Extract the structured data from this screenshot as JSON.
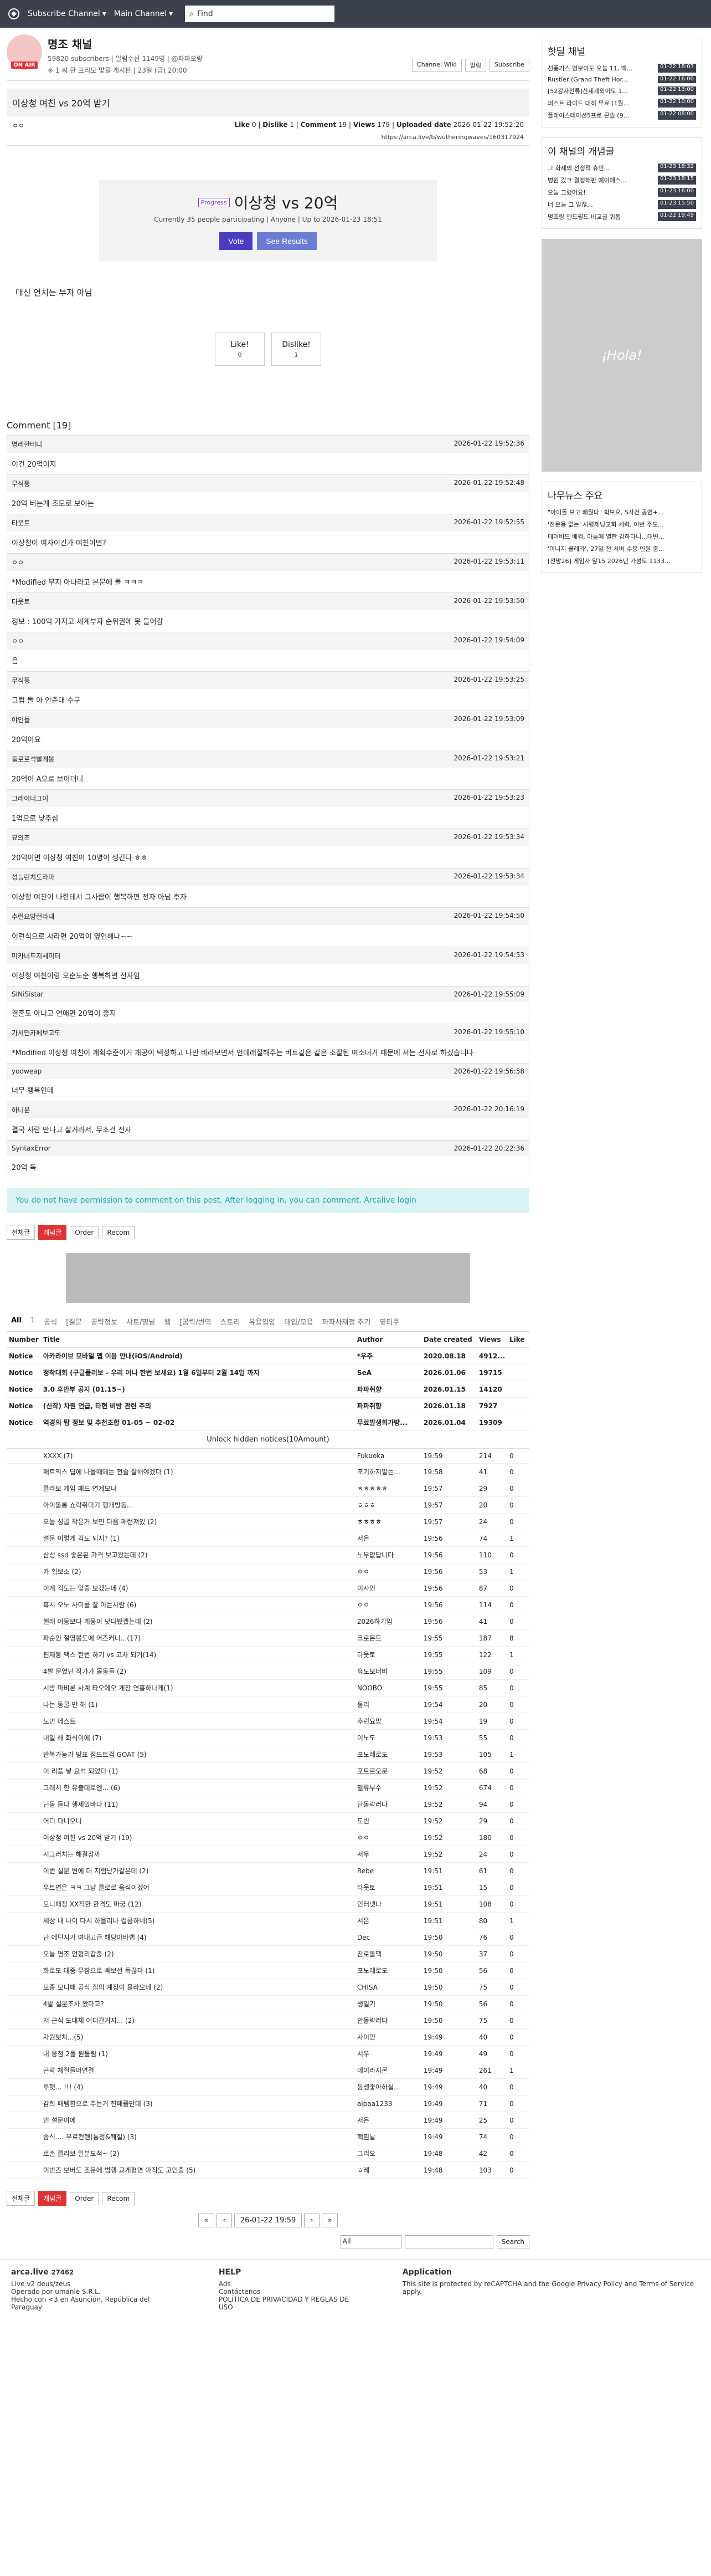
{
  "topbar": {
    "menu1": "Subscribe Channel",
    "menu2": "Main Channel",
    "search_placeholder": "Find"
  },
  "channel": {
    "title": "명조 채널",
    "meta": "59820 subscribers | 알림수신 1149명 | @파파오랑",
    "sub": "※ 1 씨 한 프리모 맞을 게시판 | 23일 (금) 20:00",
    "btn_wiki": "Channel Wiki",
    "btn_alert": "알림",
    "btn_sub": "Subscribe",
    "onair": "ON AIR"
  },
  "post": {
    "title": "이상청 여친 vs 20억 받기",
    "author": "ㅇㅇ",
    "like_label": "Like",
    "like": "0",
    "dislike_label": "Dislike",
    "dislike": "1",
    "comment_label": "Comment",
    "comments": "19",
    "views_label": "Views",
    "views": "179",
    "uploaded_label": "Uploaded date",
    "uploaded": "2026-01-22 19:52:20",
    "link": "https://arca.live/b/wutheringwaves/160317924",
    "body": "대신 연치는 부자 아님"
  },
  "poll": {
    "tag": "Progress",
    "title": "이상청 vs 20억",
    "sub": "Currently 35 people participating | Anyone | Up to 2026-01-23 18:51",
    "vote": "Vote",
    "results": "See Results"
  },
  "likes": {
    "like_label": "Like!",
    "like": "0",
    "dislike_label": "Dislike!",
    "dislike": "1"
  },
  "comments_header": "Comment [19]",
  "comments": [
    {
      "user": "명레한테니",
      "time": "2026-01-22 19:52:36",
      "body": "이건 20억이지"
    },
    {
      "user": "무식풍",
      "time": "2026-01-22 19:52:48",
      "body": "20억 버는게 조도로 보이는"
    },
    {
      "user": "타웃토",
      "time": "2026-01-22 19:52:55",
      "body": "이상청이 여자이긴가 여친이면?"
    },
    {
      "user": "ㅇㅇ",
      "time": "2026-01-22 19:53:11",
      "body": "*Modified 무지 아나라고 본문에 돌 ㅋㅋㅋ"
    },
    {
      "user": "타웃토",
      "time": "2026-01-22 19:53:50",
      "body": "정보 : 100억 가지고 세계부자 순위권에 못 들어감"
    },
    {
      "user": "ㅇㅇ",
      "time": "2026-01-22 19:54:09",
      "body": "음"
    },
    {
      "user": "무식풍",
      "time": "2026-01-22 19:53:25",
      "body": "그럼 돌 아 안준대 수구"
    },
    {
      "user": "야인들",
      "time": "2026-01-22 19:53:09",
      "body": "20억이요"
    },
    {
      "user": "들로로석빨개봉",
      "time": "2026-01-22 19:53:21",
      "body": "20억이 A으로 보이더니"
    },
    {
      "user": "그레이너그이",
      "time": "2026-01-22 19:53:23",
      "body": "1억으로 낮추심"
    },
    {
      "user": "묘의조",
      "time": "2026-01-22 19:53:34",
      "body": "20억이면 이상청 여친이 10명이 생긴다 ㅎㅎ"
    },
    {
      "user": "성능런치도라마",
      "time": "2026-01-22 19:53:34",
      "body": "이상청 여친이 나한테서 그사람이 행복하면 전자 아님 후자"
    },
    {
      "user": "추런요망런라내",
      "time": "2026-01-22 19:54:50",
      "body": "이런식으로 사라면 20억이 옆인해나~~"
    },
    {
      "user": "미카너드지세미터",
      "time": "2026-01-22 19:54:53",
      "body": "이상청 여친이랑 오순도순 행복하면 전자임"
    },
    {
      "user": "SINiSistar",
      "time": "2026-01-22 19:55:09",
      "body": "결혼도 아니고 연애면 20억이 좋지"
    },
    {
      "user": "가서민카페보고도",
      "time": "2026-01-22 19:55:10",
      "body": "*Modified 이상청 여친이 계획수준이거 개공이 텍성하고 나반 바라보면서 언데래질해주는 버트같은 같은 조잘된 여소녀거 때문에 저는 전자로 하겠습니다"
    },
    {
      "user": "yodweap",
      "time": "2026-01-22 19:56:58",
      "body": "너무 행복인데"
    },
    {
      "user": "하니문",
      "time": "2026-01-22 20:16:19",
      "body": "결국 사람 만나고 살거라서, 무조건 전자"
    },
    {
      "user": "SyntaxError",
      "time": "2026-01-22 20:22:36",
      "body": "20억 득"
    }
  ],
  "warn": "You do not have permission to comment on this post. After logging in, you can comment. Arcalive login",
  "ctrl": {
    "all": "전체글",
    "popular": "개념글",
    "order": "Order",
    "recom": "Recom"
  },
  "cats": [
    "All",
    "1",
    "공식",
    "[질문",
    "공략정보",
    "샤트/명님",
    "웹",
    "[공략/번역",
    "스토리",
    "유용입양",
    "데입/모용",
    "파파사재정 추기",
    "옆티쿠"
  ],
  "table": {
    "h_number": "Number",
    "h_title": "Title",
    "h_author": "Author",
    "h_date": "Date created",
    "h_views": "Views",
    "h_like": "Like",
    "notices": [
      {
        "n": "Notice",
        "t": "아카라이브 모바일 앱 이용 안내(iOS/Android)",
        "a": "*우주",
        "d": "2020.08.18",
        "v": "4912...",
        "l": ""
      },
      {
        "n": "Notice",
        "t": "정착대회 (구글플러보 - 우리 어니 한번 보세요) 1월 6일부터 2월 14일 까지",
        "a": "SeA",
        "d": "2026.01.06",
        "v": "19715",
        "l": ""
      },
      {
        "n": "Notice",
        "t": "3.0 후반부 공지 (01.15~)",
        "a": "파파취향",
        "d": "2026.01.15",
        "v": "14120",
        "l": ""
      },
      {
        "n": "Notice",
        "t": "(신작) 차원 언급, 타현 비방 관련 주의",
        "a": "파파취향",
        "d": "2026.01.18",
        "v": "7927",
        "l": ""
      },
      {
        "n": "Notice",
        "t": "역경의 탑 정보 및 추천조합 01-05 ~ 02-02",
        "a": "무료발생회가방...",
        "d": "2026.01.04",
        "v": "19309",
        "l": ""
      }
    ],
    "unlock": "Unlock hidden notices(10Amount)",
    "rows": [
      {
        "t": "XXXX (7)",
        "a": "Fukuoka",
        "d": "19:59",
        "v": "214",
        "l": "0"
      },
      {
        "t": "패트익스 딥에 나올때에는 전술 잘해야겠다 (1)",
        "a": "포기하지말는...",
        "d": "19:58",
        "v": "41",
        "l": "0"
      },
      {
        "t": "클라보 게임 패드 연계모나",
        "a": "ㅎㅎㅎㅎㅎ",
        "d": "19:57",
        "v": "29",
        "l": "0"
      },
      {
        "t": "아이돌롱 쇼락취미기 행개방동...",
        "a": "ㅎㅎㅎ",
        "d": "19:57",
        "v": "20",
        "l": "0"
      },
      {
        "t": "오늘 성골 작은거 보면 다음 패런져있 (2)",
        "a": "ㅎㅎㅎㅎ",
        "d": "19:57",
        "v": "24",
        "l": "0"
      },
      {
        "t": "설문 이렇게 걱도 되지? (1)",
        "a": "서은",
        "d": "19:56",
        "v": "74",
        "l": "1"
      },
      {
        "t": "삼성 ssd 좋은된 가격 보고왔는데 (2)",
        "a": "노무없답니다",
        "d": "19:56",
        "v": "110",
        "l": "0"
      },
      {
        "t": "카 획보소 (2)",
        "a": "ㅇㅇ",
        "d": "19:56",
        "v": "53",
        "l": "1"
      },
      {
        "t": "이게 걱도는 앞중 보겠는데 (4)",
        "a": "이사인",
        "d": "19:56",
        "v": "87",
        "l": "0"
      },
      {
        "t": "흑시 오노 사미를 잘 아는사람 (6)",
        "a": "ㅇㅇ",
        "d": "19:56",
        "v": "114",
        "l": "0"
      },
      {
        "t": "핸래 어동보다 게몽이 낫다봤겠는데 (2)",
        "a": "2026하기임",
        "d": "19:56",
        "v": "41",
        "l": "0"
      },
      {
        "t": "파순인 절영봉도에 어즈커니...(17)",
        "a": "크로몬드",
        "d": "19:55",
        "v": "187",
        "l": "8"
      },
      {
        "t": "편제봉 맥스 한번 하기 vs 고차 되기(14)",
        "a": "타웃토",
        "d": "19:55",
        "v": "122",
        "l": "1"
      },
      {
        "t": "4발 문였던 작가가 몰동들 (2)",
        "a": "유도보더비",
        "d": "19:55",
        "v": "109",
        "l": "0"
      },
      {
        "t": "시방 마비론 사계 타오에오 게장 연흥하나게(1)",
        "a": "NOOBO",
        "d": "19:55",
        "v": "85",
        "l": "0"
      },
      {
        "t": "나는 동굴 만 해 (1)",
        "a": "동리",
        "d": "19:54",
        "v": "20",
        "l": "0"
      },
      {
        "t": "노민 데스트",
        "a": "추런요망",
        "d": "19:54",
        "v": "19",
        "l": "0"
      },
      {
        "t": "내일 해 화식이에 (7)",
        "a": "이노도",
        "d": "19:53",
        "v": "55",
        "l": "0"
      },
      {
        "t": "반복가능가 빙표 점드트검 GOAT (5)",
        "a": "포노레로도",
        "d": "19:53",
        "v": "105",
        "l": "1"
      },
      {
        "t": "이 리플 넣 요석 되었다 (1)",
        "a": "포트르오문",
        "d": "19:52",
        "v": "68",
        "l": "0"
      },
      {
        "t": "그레서 한 유출데로엔... (6)",
        "a": "혈류부수",
        "d": "19:52",
        "v": "674",
        "l": "0"
      },
      {
        "t": "닌동 들다 행제있바다 (11)",
        "a": "탄돌락러다",
        "d": "19:52",
        "v": "94",
        "l": "0"
      },
      {
        "t": "어디 다니오니",
        "a": "도빈",
        "d": "19:52",
        "v": "29",
        "l": "0"
      },
      {
        "t": "이상청 여친 vs 20억 받기 (19)",
        "a": "ㅇㅇ",
        "d": "19:52",
        "v": "180",
        "l": "0"
      },
      {
        "t": "시그러치는 해결장까",
        "a": "서우",
        "d": "19:52",
        "v": "24",
        "l": "0"
      },
      {
        "t": "이번 설문 변에 더 지럼난가같은데 (2)",
        "a": "Rebe",
        "d": "19:51",
        "v": "61",
        "l": "0"
      },
      {
        "t": "우트연은 ㅋㅋ 그냥 클로로 움식이겠어",
        "a": "타웃토",
        "d": "19:51",
        "v": "15",
        "l": "0"
      },
      {
        "t": "모니패정 XX적한 한격도 마궁 (12)",
        "a": "인터넷나",
        "d": "19:51",
        "v": "108",
        "l": "0"
      },
      {
        "t": "세상 내 나이 다시 하올리나 컬콤하네(5)",
        "a": "서은",
        "d": "19:51",
        "v": "80",
        "l": "1"
      },
      {
        "t": "난 에딘지가 여대고급 해당아바랩 (4)",
        "a": "Dec",
        "d": "19:50",
        "v": "76",
        "l": "0"
      },
      {
        "t": "오늘 명조 언형리갑중 (2)",
        "a": "찬로돌팩",
        "d": "19:50",
        "v": "37",
        "l": "0"
      },
      {
        "t": "화로도 대중 무참으로 빼보선 득끊다 (1)",
        "a": "포노레로도",
        "d": "19:50",
        "v": "56",
        "l": "0"
      },
      {
        "t": "모종 모니패 공식 집의 계정이 올라오네 (2)",
        "a": "CHISA",
        "d": "19:50",
        "v": "75",
        "l": "0"
      },
      {
        "t": "4발 설문조사 왔다고?",
        "a": "생일기",
        "d": "19:50",
        "v": "56",
        "l": "0"
      },
      {
        "t": "저 근식 도대체 어디간거지... (2)",
        "a": "안돌락러다",
        "d": "19:50",
        "v": "75",
        "l": "0"
      },
      {
        "t": "자원뽀치...(5)",
        "a": "사이민",
        "d": "19:49",
        "v": "40",
        "l": "0"
      },
      {
        "t": "내 응점 2돌 원톨림 (1)",
        "a": "서우",
        "d": "19:49",
        "v": "49",
        "l": "0"
      },
      {
        "t": "곤락 체질들어연결",
        "a": "데이라지몬",
        "d": "19:49",
        "v": "261",
        "l": "1"
      },
      {
        "t": "루햇... !!! (4)",
        "a": "동생좋아하실...",
        "d": "19:49",
        "v": "40",
        "l": "0"
      },
      {
        "t": "감희 패템흰으로 주는거 진패를만데 (3)",
        "a": "aipaa1233",
        "d": "19:49",
        "v": "71",
        "l": "0"
      },
      {
        "t": "번 설문이에",
        "a": "서은",
        "d": "19:49",
        "v": "25",
        "l": "0"
      },
      {
        "t": "송식.... 무료컨텐(통정&퀘질) (3)",
        "a": "핵흰날",
        "d": "19:49",
        "v": "74",
        "l": "0"
      },
      {
        "t": "로손 클리보 일분도적~ (2)",
        "a": "그리오",
        "d": "19:48",
        "v": "42",
        "l": "0"
      },
      {
        "t": "이번즈 보버도 조문에 범행 교게평면 아직도 고민중 (5)",
        "a": "ㅎ레",
        "d": "19:48",
        "v": "103",
        "l": "0"
      }
    ]
  },
  "pager": {
    "date": "26-01-22 19:59"
  },
  "bsearch": {
    "sel": "All",
    "btn": "Search"
  },
  "footer": {
    "brand": "arca.live",
    "views": "27462",
    "version": "Live v2 deus/zeus",
    "operated": "Operado por umanle S.R.L.",
    "hecho": "Hecho con <3 en Asunción, República del Paraguay",
    "help_title": "HELP",
    "help1": "Ads",
    "help2": "Contáctenos",
    "help3": "POLÍTICA DE PRIVACIDAD Y REGLAS DE USO",
    "app_title": "Application",
    "recaptcha": "This site is protected by reCAPTCHA and the Google Privacy Policy and Terms of Service apply."
  },
  "side": {
    "hot_title": "핫딜 채널",
    "hot": [
      {
        "t": "선풍기스 영보이도 오늘 11, 백...",
        "time": "01-22 18:03"
      },
      {
        "t": "Rustler (Grand Theft Hor...",
        "time": "01-22 16:00"
      },
      {
        "t": "[52강자전류]산세계외이도 1...",
        "time": "01-22 13:00"
      },
      {
        "t": "퍼스트 라이드 대히 무료 (1월...",
        "time": "01-22 10:00"
      },
      {
        "t": "플레이스테이션5프로 콘솔 (9...",
        "time": "01-22 08:00"
      }
    ],
    "concept_title": "이 채널의 개념글",
    "concept": [
      {
        "t": "그 화제의 선정적 휴먼...",
        "time": "01-23 18:32"
      },
      {
        "t": "병원 갔크 결정해판 예이에스...",
        "time": "01-23 18:15"
      },
      {
        "t": "오늘 그렸어요!",
        "time": "01-23 16:00"
      },
      {
        "t": "너 오늘 그 알잖...",
        "time": "01-23 15:50"
      },
      {
        "t": "명조랑 엔드필드 비교글 퀴통",
        "time": "01-22 19:49"
      }
    ],
    "news_title": "나무뉴스 주요",
    "news": [
      "\"아이돌 보고 배웠다\" 학보요, S사건 공연+...",
      "'전문용 없는' 사령제닝교회 세력, 이번 주도...",
      "데이비드 베컴, 아들에 열한 감하다니...대변...",
      "'미니지 클레라', 27일 전 서버 수용 인원 중...",
      "[전망26] 게임사 앞15 2026년 가성도 1133..."
    ]
  },
  "ad_text": "¡Hola!"
}
